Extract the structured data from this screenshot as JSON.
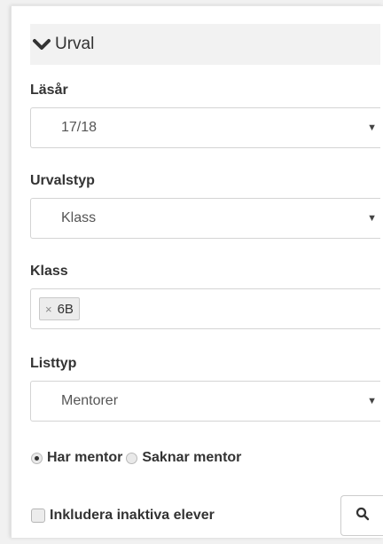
{
  "header": {
    "title": "Urval",
    "icon": "chevron-down-icon"
  },
  "lasar": {
    "label": "Läsår",
    "value": "17/18"
  },
  "urvalstyp": {
    "label": "Urvalstyp",
    "value": "Klass"
  },
  "klass": {
    "label": "Klass",
    "tags": [
      {
        "text": "6B",
        "remove": "×"
      }
    ]
  },
  "listtyp": {
    "label": "Listtyp",
    "value": "Mentorer"
  },
  "mentor_filter": {
    "options": [
      {
        "label": "Har mentor",
        "checked": true
      },
      {
        "label": "Saknar mentor",
        "checked": false
      }
    ]
  },
  "inactive": {
    "label": "Inkludera inaktiva elever",
    "checked": false
  },
  "search_button": {
    "icon": "search-icon"
  },
  "caret": "▼"
}
